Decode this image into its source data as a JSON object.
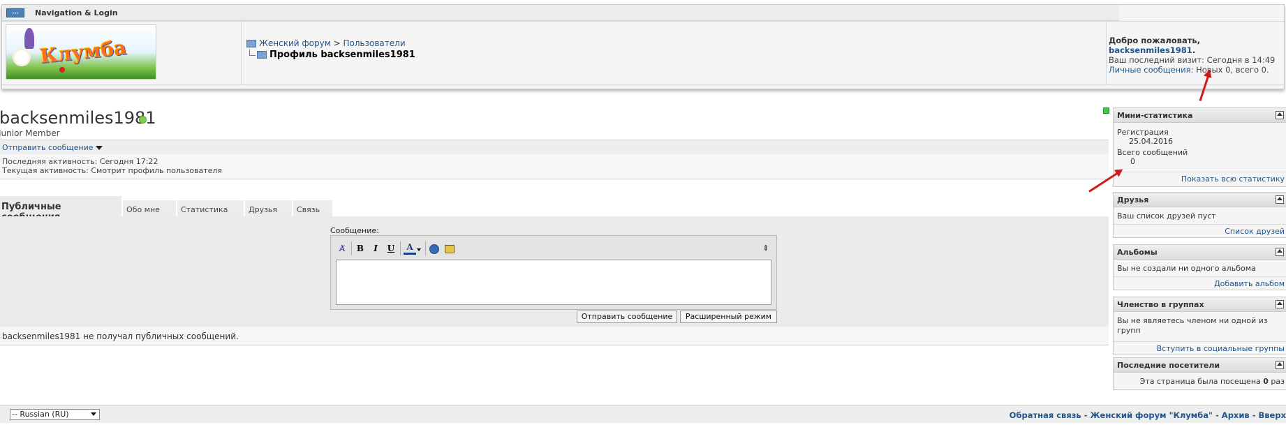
{
  "nav": {
    "header_title": "Navigation & Login",
    "logo_text": "Клумба",
    "breadcrumb_forum": "Женский форум",
    "breadcrumb_sep": ">",
    "breadcrumb_users": "Пользователи",
    "current_page": "Профиль backsenmiles1981"
  },
  "welcome": {
    "greeting": "Добро пожаловать,",
    "username": "backsenmiles1981",
    "last_visit_label": "Ваш последний визит:",
    "last_visit_value": "Сегодня в 14:49",
    "pm_label": "Личные сообщения:",
    "pm_value": "Новых 0, всего 0."
  },
  "profile": {
    "username": "backsenmiles1981",
    "user_title": "Junior Member",
    "send_message_link": "Отправить сообщение",
    "last_activity": "Последняя активность: Сегодня 17:22",
    "current_activity": "Текущая активность: Смотрит профиль пользователя"
  },
  "tabs": [
    "Публичные сообщения",
    "Обо мне",
    "Статистика",
    "Друзья",
    "Связь"
  ],
  "editor": {
    "label": "Сообщение:",
    "submit_button": "Отправить сообщение",
    "advanced_button": "Расширенный режим",
    "toolbar": {
      "bold": "B",
      "italic": "I",
      "underline": "U",
      "font_color": "A",
      "resize": "⇕",
      "remove_format": "A̸"
    }
  },
  "no_messages": "backsenmiles1981 не получал публичных сообщений.",
  "sidebar": {
    "ministats": {
      "title": "Мини-статистика",
      "reg_label": "Регистрация",
      "reg_value": "25.04.2016",
      "posts_label": "Всего сообщений",
      "posts_value": "0",
      "link": "Показать всю статистику"
    },
    "friends": {
      "title": "Друзья",
      "text": "Ваш список друзей пуст",
      "link": "Список друзей"
    },
    "albums": {
      "title": "Альбомы",
      "text": "Вы не создали ни одного альбома",
      "link": "Добавить альбом"
    },
    "groups": {
      "title": "Членство в группах",
      "text": "Вы не являетесь членом ни одной из групп",
      "link": "Вступить в социальные группы"
    },
    "visitors": {
      "title": "Последние посетители",
      "text_prefix": "Эта страница была посещена",
      "count": "0",
      "text_suffix": "раз"
    }
  },
  "footer": {
    "language": "-- Russian (RU)",
    "feedback": "Обратная связь",
    "home": "Женский форум \"Клумба\"",
    "archive": "Архив",
    "top": "Вверх",
    "sep": "-"
  },
  "colors": {
    "link": "#22558b",
    "annotation_arrow": "#d01818",
    "online": "#7ccf4a"
  }
}
